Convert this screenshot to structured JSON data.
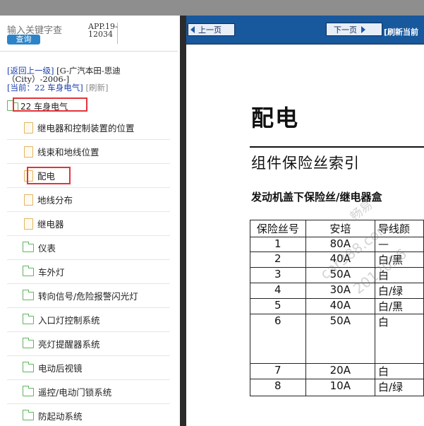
{
  "search": {
    "placeholder": "输入关键字查",
    "button": "查询"
  },
  "app_code": "APP.19-12034",
  "nav": {
    "back": "[返回上一级]",
    "path": "[G-广汽本田-思迪（City）-2006-]",
    "current_label": "[当前：",
    "current_value": "22 车身电气",
    "current_close": "]",
    "refresh": "[刷新]"
  },
  "tree": {
    "root": "22 车身电气",
    "items": [
      {
        "label": "继电器和控制装置的位置",
        "icon": "file-icon"
      },
      {
        "label": "线束和地线位置",
        "icon": "file-icon"
      },
      {
        "label": "配电",
        "icon": "file-icon"
      },
      {
        "label": "地线分布",
        "icon": "file-icon"
      },
      {
        "label": "继电器",
        "icon": "file-icon"
      },
      {
        "label": "仪表",
        "icon": "folder-icon"
      },
      {
        "label": "车外灯",
        "icon": "folder-icon"
      },
      {
        "label": "转向信号/危险报警闪光灯",
        "icon": "folder-icon"
      },
      {
        "label": "入口灯控制系统",
        "icon": "folder-icon"
      },
      {
        "label": "亮灯提醒器系统",
        "icon": "folder-icon"
      },
      {
        "label": "电动后视镜",
        "icon": "folder-icon"
      },
      {
        "label": "遥控/电动门锁系统",
        "icon": "folder-icon"
      },
      {
        "label": "防起动系统",
        "icon": "folder-icon"
      }
    ]
  },
  "toolbar": {
    "prev": "上一页",
    "next": "下一页",
    "refresh_current": "[刷新当前"
  },
  "doc": {
    "title": "配电",
    "subtitle": "组件保险丝索引",
    "section": "发动机盖下保险丝/继电器盒",
    "headers": [
      "保险丝号",
      "安培",
      "导线颜"
    ],
    "rows": [
      [
        "1",
        "80A",
        "—"
      ],
      [
        "2",
        "40A",
        "白/黑"
      ],
      [
        "3",
        "50A",
        "白"
      ],
      [
        "4",
        "30A",
        "白/绿"
      ],
      [
        "5",
        "40A",
        "白/黑"
      ],
      [
        "6",
        "50A",
        "白"
      ],
      [
        "7",
        "20A",
        "白"
      ],
      [
        "8",
        "10A",
        "白/绿"
      ]
    ],
    "watermark": [
      "畅易",
      "car388.com",
      "2012056"
    ]
  }
}
